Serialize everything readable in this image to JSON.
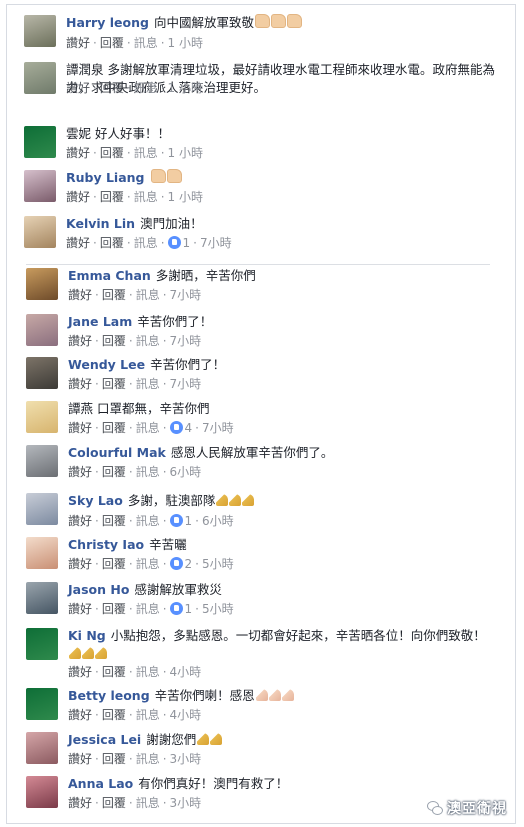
{
  "comments": [
    {
      "name": "Harry leong",
      "text": "向中國解放軍致敬",
      "emoji": "thumb",
      "emoji_count": 3,
      "actions": {
        "like": "讚好",
        "reply": "回覆",
        "message": "訊息"
      },
      "likes": "",
      "time": "1 小時"
    },
    {
      "name": "",
      "text": "譚潤泉 多謝解放軍清理垃圾，最好請收理水電工程師來收理水電。政府無能為力，求中央政府派人落來治理更好。",
      "emoji": "",
      "emoji_count": 0,
      "actions": {
        "like": "讚好",
        "reply": "回覆",
        "message": "訊息"
      },
      "likes": "",
      "time": "1 小時"
    },
    {
      "name": "",
      "text": "雲妮 好人好事！！",
      "emoji": "",
      "emoji_count": 0,
      "actions": {
        "like": "讚好",
        "reply": "回覆",
        "message": "訊息"
      },
      "likes": "",
      "time": "1 小時"
    },
    {
      "name": "Ruby Liang",
      "text": "",
      "emoji": "thumb",
      "emoji_count": 2,
      "actions": {
        "like": "讚好",
        "reply": "回覆",
        "message": "訊息"
      },
      "likes": "",
      "time": "1 小時"
    },
    {
      "name": "Kelvin Lin",
      "text": "澳門加油！",
      "emoji": "",
      "emoji_count": 0,
      "actions": {
        "like": "讚好",
        "reply": "回覆",
        "message": "訊息"
      },
      "likes": "1",
      "time": "7小時"
    },
    {
      "name": "Emma Chan",
      "text": "多謝晒，辛苦你們",
      "emoji": "",
      "emoji_count": 0,
      "actions": {
        "like": "讚好",
        "reply": "回覆",
        "message": "訊息"
      },
      "likes": "",
      "time": "7小時"
    },
    {
      "name": "Jane Lam",
      "text": "辛苦你們了！",
      "emoji": "",
      "emoji_count": 0,
      "actions": {
        "like": "讚好",
        "reply": "回覆",
        "message": "訊息"
      },
      "likes": "",
      "time": "7小時"
    },
    {
      "name": "Wendy Lee",
      "text": "辛苦你們了！",
      "emoji": "",
      "emoji_count": 0,
      "actions": {
        "like": "讚好",
        "reply": "回覆",
        "message": "訊息"
      },
      "likes": "",
      "time": "7小時"
    },
    {
      "name": "",
      "text": "譚燕 口罩都無，辛苦你們",
      "emoji": "",
      "emoji_count": 0,
      "actions": {
        "like": "讚好",
        "reply": "回覆",
        "message": "訊息"
      },
      "likes": "4",
      "time": "7小時"
    },
    {
      "name": "Colourful Mak",
      "text": "感恩人民解放軍辛苦你們了。",
      "emoji": "",
      "emoji_count": 0,
      "actions": {
        "like": "讚好",
        "reply": "回覆",
        "message": "訊息"
      },
      "likes": "",
      "time": "6小時"
    },
    {
      "name": "Sky Lao",
      "text": "多謝，駐澳部隊",
      "emoji": "pray",
      "emoji_count": 3,
      "actions": {
        "like": "讚好",
        "reply": "回覆",
        "message": "訊息"
      },
      "likes": "1",
      "time": "6小時"
    },
    {
      "name": "Christy Iao",
      "text": "辛苦曬",
      "emoji": "",
      "emoji_count": 0,
      "actions": {
        "like": "讚好",
        "reply": "回覆",
        "message": "訊息"
      },
      "likes": "2",
      "time": "5小時"
    },
    {
      "name": "Jason Ho",
      "text": "感謝解放軍救災",
      "emoji": "",
      "emoji_count": 0,
      "actions": {
        "like": "讚好",
        "reply": "回覆",
        "message": "訊息"
      },
      "likes": "1",
      "time": "5小時"
    },
    {
      "name": "Ki Ng",
      "text": "小點抱怨，多點感恩。一切都會好起來，辛苦晒各位！向你們致敬！",
      "emoji": "pray",
      "emoji_count": 3,
      "actions": {
        "like": "讚好",
        "reply": "回覆",
        "message": "訊息"
      },
      "likes": "",
      "time": "4小時"
    },
    {
      "name": "Betty leong",
      "text": "辛苦你們喇！感恩",
      "emoji": "prayp",
      "emoji_count": 3,
      "actions": {
        "like": "讚好",
        "reply": "回覆",
        "message": "訊息"
      },
      "likes": "",
      "time": "4小時"
    },
    {
      "name": "Jessica Lei",
      "text": "謝謝您們",
      "emoji": "pray",
      "emoji_count": 2,
      "actions": {
        "like": "讚好",
        "reply": "回覆",
        "message": "訊息"
      },
      "likes": "",
      "time": "3小時"
    },
    {
      "name": "Anna Lao",
      "text": "有你們真好！澳門有救了！",
      "emoji": "",
      "emoji_count": 0,
      "actions": {
        "like": "讚好",
        "reply": "回覆",
        "message": "訊息"
      },
      "likes": "",
      "time": "3小時"
    }
  ],
  "watermark": {
    "text": "澳亞衛視",
    "icon": "wechat-icon"
  },
  "colors": {
    "name": "#365899",
    "text": "#1d2129",
    "meta": "#90949c",
    "like_badge": "#5890ff"
  }
}
